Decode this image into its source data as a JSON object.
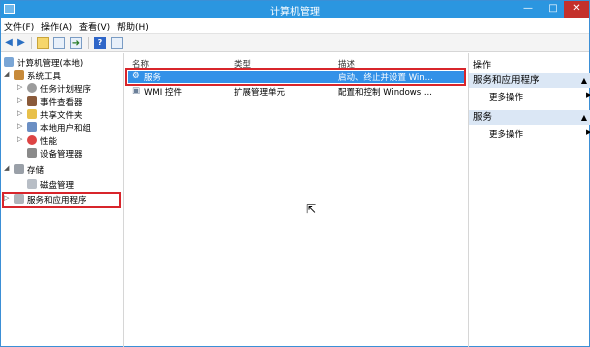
{
  "window": {
    "title": "计算机管理"
  },
  "menu": [
    "文件(F)",
    "操作(A)",
    "查看(V)",
    "帮助(H)"
  ],
  "tree": {
    "root": "计算机管理(本地)",
    "system_tools": "系统工具",
    "task_scheduler": "任务计划程序",
    "event_viewer": "事件查看器",
    "shared_folders": "共享文件夹",
    "local_users": "本地用户和组",
    "performance": "性能",
    "device_manager": "设备管理器",
    "storage": "存储",
    "disk_management": "磁盘管理",
    "services_apps": "服务和应用程序"
  },
  "columns": {
    "name": "名称",
    "type": "类型",
    "desc": "描述"
  },
  "rows": [
    {
      "name": "服务",
      "type": "",
      "desc": "启动、终止并设置 Win..."
    },
    {
      "name": "WMI 控件",
      "type": "扩展管理单元",
      "desc": "配置和控制 Windows ..."
    }
  ],
  "actions": {
    "title": "操作",
    "group1": "服务和应用程序",
    "group1_more": "更多操作",
    "group2": "服务",
    "group2_more": "更多操作"
  },
  "icons": [
    "computer-icon",
    "back-icon",
    "forward-icon",
    "help-icon"
  ],
  "colors": {
    "titlebar": "#2b96e0",
    "selection": "#3391e8",
    "highlight_box": "#d8252b",
    "action_header": "#dbe7f5"
  }
}
